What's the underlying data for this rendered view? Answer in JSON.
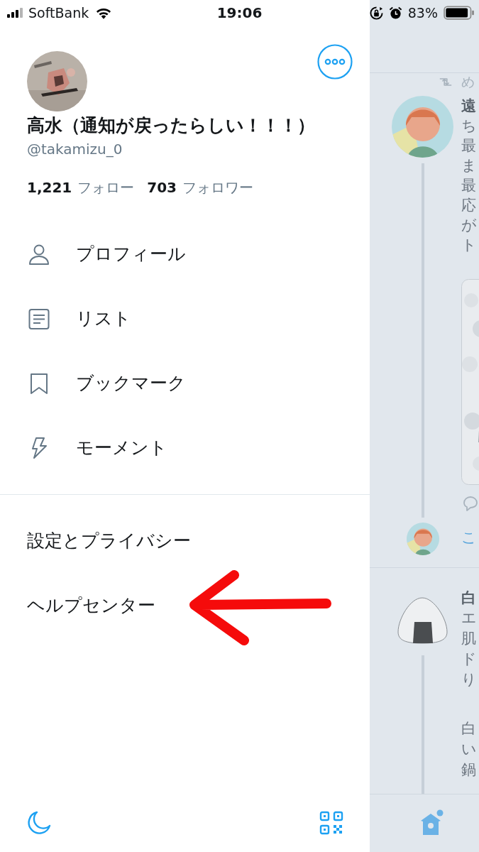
{
  "status_bar": {
    "carrier": "SoftBank",
    "time": "19:06",
    "battery": "83%"
  },
  "profile": {
    "name": "高水（通知が戻ったらしい！！！）",
    "handle": "@takamizu_0",
    "following_count": "1,221",
    "following_label": "フォロー",
    "followers_count": "703",
    "followers_label": "フォロワー"
  },
  "menu": [
    {
      "kind": "profile",
      "label": "プロフィール"
    },
    {
      "kind": "lists",
      "label": "リスト"
    },
    {
      "kind": "bookmarks",
      "label": "ブックマーク"
    },
    {
      "kind": "moments",
      "label": "モーメント"
    }
  ],
  "secondary_menu": [
    {
      "label": "設定とプライバシー"
    },
    {
      "label": "ヘルプセンター"
    }
  ],
  "timeline": {
    "tweets": [
      {
        "retweet_context": "め",
        "name": "遠",
        "paragraphs": [
          [
            "ち",
            "最",
            "ま",
            "最",
            "応",
            "が",
            "ト"
          ]
        ],
        "media": {
          "kind": "picture"
        },
        "thread_reply": {
          "text": "こ"
        }
      },
      {
        "name": "白",
        "paragraphs": [
          [
            "エ",
            "肌",
            "ド",
            "り"
          ],
          [
            "白",
            "い",
            "鍋"
          ]
        ]
      }
    ]
  }
}
